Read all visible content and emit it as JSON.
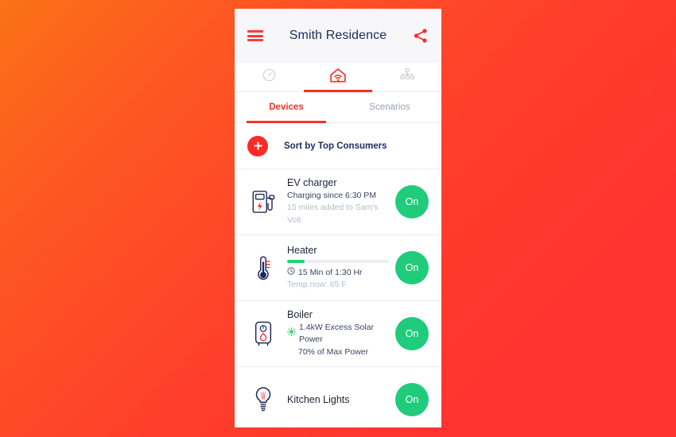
{
  "header": {
    "title": "Smith Residence",
    "menu_icon": "hamburger-menu-icon",
    "share_icon": "share-icon"
  },
  "icon_tabs": [
    {
      "name": "gauge-icon",
      "label": "Energy",
      "active": false
    },
    {
      "name": "home-wifi-icon",
      "label": "Home",
      "active": true
    },
    {
      "name": "network-tree-icon",
      "label": "Network",
      "active": false
    }
  ],
  "text_tabs": [
    {
      "label": "Devices",
      "active": true
    },
    {
      "label": "Scenarios",
      "active": false
    }
  ],
  "sort_row": {
    "add_icon": "plus-icon",
    "label": "Sort by Top Consumers"
  },
  "devices": [
    {
      "name": "EV charger",
      "icon": "ev-charging-station-icon",
      "line1": "Charging since 6:30 PM",
      "line2": "15 miles added to Sam's Volt",
      "toggle_label": "On"
    },
    {
      "name": "Heater",
      "icon": "thermometer-icon",
      "progress_percent": 17,
      "line1": "15 Min of 1:30 Hr",
      "line1_icon": "clock-icon",
      "line2": "Temp now: 65 F",
      "toggle_label": "On"
    },
    {
      "name": "Boiler",
      "icon": "water-boiler-icon",
      "line1": "1.4kW Excess Solar Power",
      "line1_icon": "sun-icon",
      "line2": "70% of Max Power",
      "toggle_label": "On"
    },
    {
      "name": "Kitchen Lights",
      "icon": "lightbulb-icon",
      "toggle_label": "On"
    }
  ],
  "colors": {
    "brand_red": "#fb2b26",
    "toggle_green": "#21cb7c",
    "progress_green": "#16d66f",
    "title_navy": "#1f2a5e",
    "muted_gray": "#b6bac6",
    "background_start": "#fb7216",
    "background_end": "#ff3330"
  }
}
